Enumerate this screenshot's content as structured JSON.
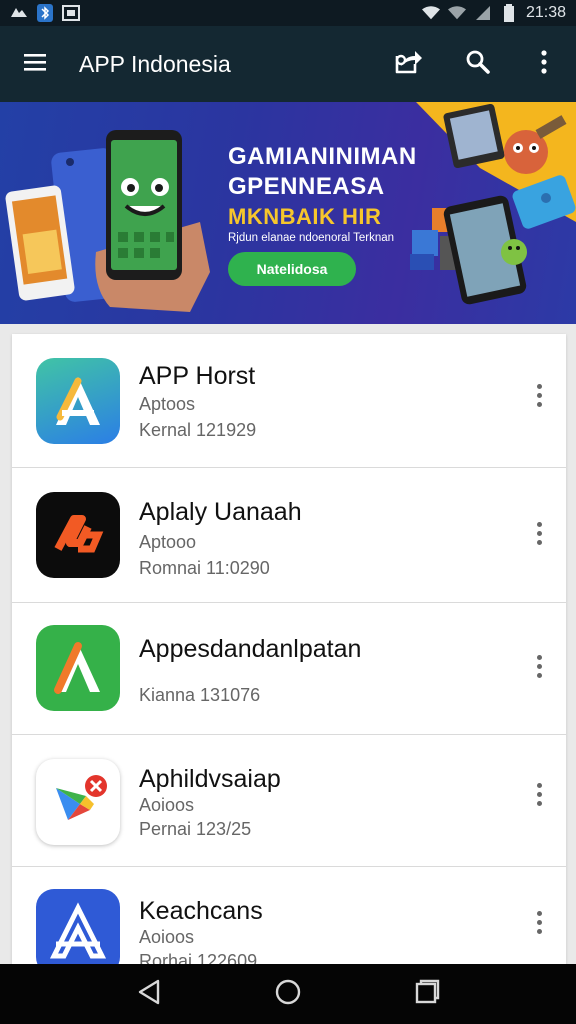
{
  "status_bar": {
    "time": "21:38",
    "left_icons": [
      "photos-icon",
      "bluetooth-icon",
      "gallery-icon"
    ],
    "right_icons": [
      "wifi-icon",
      "signal-icon",
      "signal-icon-2",
      "battery-icon"
    ]
  },
  "toolbar": {
    "title": "APP Indonesia",
    "icons": [
      "menu-icon",
      "share-icon",
      "search-icon",
      "more-vert-icon"
    ]
  },
  "banner": {
    "headline_line1": "GAMIANINIMAN",
    "headline_line2": "GPENNEASA",
    "headline_line3": "MKNBAIK HIR",
    "subtitle": "Rjdun elanae ndoenoral Terknan",
    "cta_label": "Natelidosa",
    "colors": {
      "bg": "#2340a6",
      "accent": "#f4b61e",
      "cta": "#2fb24e"
    }
  },
  "apps": [
    {
      "name": "APP Horst",
      "line1": "Aptoos",
      "line2": "Kernal 121929",
      "icon": "app-store-a-icon",
      "icon_bg": "#2f8fe0"
    },
    {
      "name": "Aplaly Uanaah",
      "line1": "Aptooo",
      "line2": "Romnai 11:0290",
      "icon": "orange-logo-icon",
      "icon_bg": "#0c0c0c"
    },
    {
      "name": "Appesdandanlpatan",
      "line1": "",
      "line2": "Kianna 131076",
      "icon": "green-a-icon",
      "icon_bg": "#35b149"
    },
    {
      "name": "Aphildvsaiap",
      "line1": "Aoioos",
      "line2": "Pernai 123/25",
      "icon": "play-store-icon",
      "icon_bg": "#ffffff"
    },
    {
      "name": "Keachcans",
      "line1": "Aoioos",
      "line2": "Rorhai 122609",
      "icon": "blue-a-icon",
      "icon_bg": "#2f5ad6"
    }
  ],
  "nav": {
    "icons": [
      "back-icon",
      "home-icon",
      "recents-icon"
    ]
  }
}
